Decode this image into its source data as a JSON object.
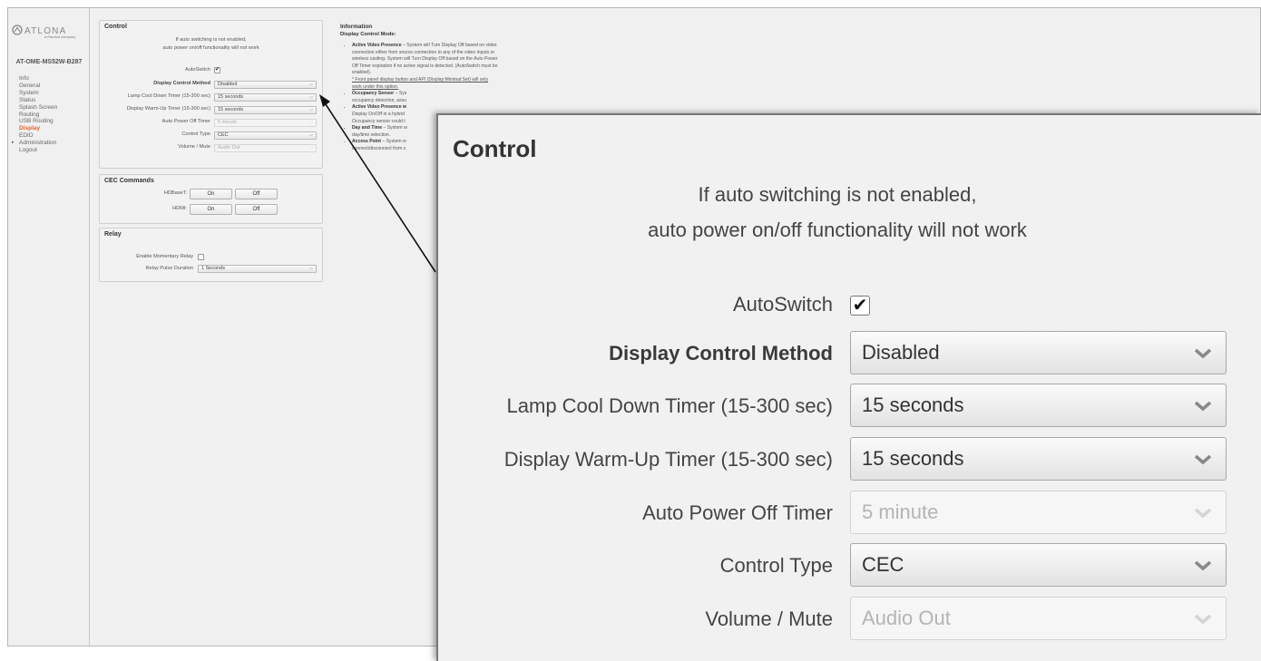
{
  "brand": {
    "logo_text": "ATLONA",
    "logo_sub": "a Panduit company",
    "model": "AT-OME-MS52W-B287"
  },
  "sidebar": {
    "items": [
      {
        "label": "Info"
      },
      {
        "label": "General"
      },
      {
        "label": "System"
      },
      {
        "label": "Status"
      },
      {
        "label": "Splash Screen"
      },
      {
        "label": "Routing"
      },
      {
        "label": "USB Routing"
      },
      {
        "label": "Display",
        "active": true
      },
      {
        "label": "EDID"
      },
      {
        "label": "Administration",
        "expandable": true
      },
      {
        "label": "Logout"
      }
    ]
  },
  "control": {
    "title": "Control",
    "notice_line1": "If auto switching is not enabled,",
    "notice_line2": "auto power on/off functionality will not work",
    "autoswitch_label": "AutoSwitch",
    "autoswitch_checked": true,
    "display_control_method_label": "Display Control Method",
    "display_control_method_value": "Disabled",
    "lamp_cool_down_label": "Lamp Cool Down Timer (15-300 sec)",
    "lamp_cool_down_value": "15 seconds",
    "display_warm_up_label": "Display Warm-Up Timer (15-300 sec)",
    "display_warm_up_value": "15 seconds",
    "auto_power_off_label": "Auto Power Off Timer",
    "auto_power_off_value": "5 minute",
    "control_type_label": "Control Type",
    "control_type_value": "CEC",
    "volume_mute_label": "Volume / Mute",
    "volume_mute_value": "Audio Out"
  },
  "cec": {
    "title": "CEC Commands",
    "hdbaset_label": "HDBaseT:",
    "hdmi_label": "HDMI:",
    "on_label": "On",
    "off_label": "Off"
  },
  "relay": {
    "title": "Relay",
    "momentary_label": "Enable Momentary Relay",
    "momentary_checked": false,
    "pulse_label": "Relay Pulse Duration",
    "pulse_value": "1 Seconds"
  },
  "information": {
    "title": "Information",
    "subtitle": "Display Control Mode:",
    "i1_title": "Active Video Presence",
    "i1_l1": " – System will Turn Display Off based on video",
    "i1_l2": "connection either from source connection to any of the video inputs or",
    "i1_l3": "wireless casting. System will Turn Display Off based on the Auto Power",
    "i1_l4": "Off Timer expiration if no active signal is detected. (AutoSwitch must be",
    "i1_l5": "enabled).",
    "i1_l6": "* Front panel display button and API (Display:Minimal:Set) will only",
    "i1_l7": "work under this option.",
    "i2_title": "Occupancy Sensor",
    "i2_l1": " – Sys",
    "i2_l2": "occupancy detection, assu",
    "i3_title": "Active Video Presence w",
    "i3_l1": "Display On/Off in a hybrid",
    "i3_l2": "Occupancy sensor could t",
    "i4_title": "Day and Time",
    "i4_l1": " – System w",
    "i4_l2": "day/time selection.",
    "i5_title": "Access Point",
    "i5_l1": " – System w",
    "i5_l2": "connect/disconnect from s"
  },
  "colors": {
    "accent": "#e8602c",
    "panel_bg": "#f2f2f2",
    "app_bg": "#f0f0f0"
  },
  "icons": {
    "checkbox_check": "check-icon",
    "select_arrow": "chevron-down-icon",
    "nav_expand": "triangle-right-icon"
  }
}
